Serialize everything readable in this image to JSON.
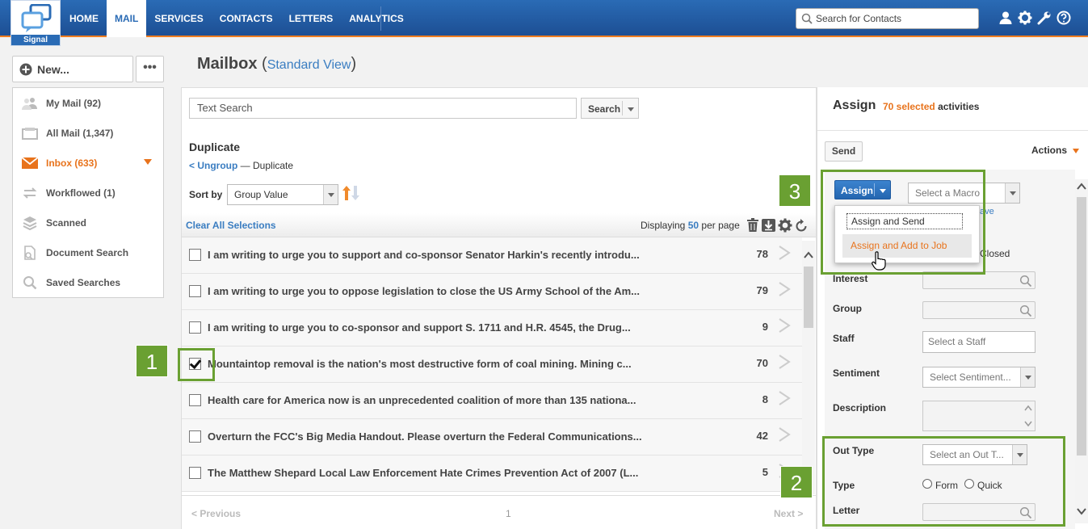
{
  "app": {
    "logo_label": "Signal",
    "nav": [
      "HOME",
      "MAIL",
      "SERVICES",
      "CONTACTS",
      "LETTERS",
      "ANALYTICS"
    ],
    "active_nav": "MAIL",
    "search_placeholder": "Search for Contacts",
    "brand_color": "#2a6bb5",
    "accent_color": "#e8731c"
  },
  "sidebar": {
    "new_label": "New...",
    "more_label": "•••",
    "items": [
      {
        "label": "My Mail (92)",
        "icon": "people-icon"
      },
      {
        "label": "All Mail (1,347)",
        "icon": "mailbox-icon"
      },
      {
        "label": "Inbox (633)",
        "icon": "envelope-icon",
        "active": true
      },
      {
        "label": "Workflowed (1)",
        "icon": "arrows-icon"
      },
      {
        "label": "Scanned",
        "icon": "layers-icon"
      },
      {
        "label": "Document Search",
        "icon": "document-search-icon"
      },
      {
        "label": "Saved Searches",
        "icon": "search-icon"
      }
    ]
  },
  "page": {
    "title": "Mailbox",
    "paren_open": "(",
    "view": "Standard View",
    "paren_close": ")"
  },
  "list": {
    "text_search_placeholder": "Text Search",
    "search_label": "Search",
    "group_title": "Duplicate",
    "ungroup_label": "< Ungroup",
    "breadcrumb_sep": "—",
    "breadcrumb_current": "Duplicate",
    "sort_by_label": "Sort by",
    "sort_value": "Group Value",
    "clear_selections": "Clear All Selections",
    "displaying_prefix": "Displaying",
    "per_page": "50",
    "per_page_suffix": "per page",
    "rows": [
      {
        "subject": "I am writing to urge you to support and co-sponsor Senator Harkin's recently introdu...",
        "count": "78",
        "checked": false
      },
      {
        "subject": "I am writing to urge you to oppose legislation to close the US Army School of the Am...",
        "count": "79",
        "checked": false
      },
      {
        "subject": "I am writing to urge you to co-sponsor and support S. 1711 and H.R. 4545, the Drug...",
        "count": "9",
        "checked": false
      },
      {
        "subject": "Mountaintop removal is the nation's most destructive form of coal mining. Mining c...",
        "count": "70",
        "checked": true
      },
      {
        "subject": "Health care for America now is an unprecedented coalition of more than 135 nationa...",
        "count": "8",
        "checked": false
      },
      {
        "subject": "Overturn the FCC's Big Media Handout. Please overturn the Federal Communications...",
        "count": "42",
        "checked": false
      },
      {
        "subject": "The Matthew Shepard Local Law Enforcement Hate Crimes Prevention Act of 2007 (L...",
        "count": "5",
        "checked": false
      }
    ],
    "pager": {
      "previous": "< Previous",
      "page": "1",
      "next": "Next >"
    }
  },
  "assign": {
    "title": "Assign",
    "selected_count": "70 selected",
    "selected_suffix": "activities",
    "send_label": "Send",
    "actions_label": "Actions",
    "assign_button": "Assign",
    "macro_placeholder": "Select a Macro",
    "save_link": "ave",
    "closed_label": "Closed",
    "dropdown_options": [
      "Assign and Send",
      "Assign and Add to Job"
    ],
    "fields": {
      "interest": "Interest",
      "group": "Group",
      "staff": "Staff",
      "staff_placeholder": "Select a Staff",
      "sentiment": "Sentiment",
      "sentiment_placeholder": "Select Sentiment...",
      "description": "Description",
      "out_type": "Out Type",
      "out_type_placeholder": "Select an Out T...",
      "type": "Type",
      "type_options": [
        "Form",
        "Quick"
      ],
      "letter": "Letter"
    }
  },
  "annotations": {
    "step_1": "1",
    "step_2": "2",
    "step_3": "3",
    "color": "#6aa032"
  }
}
